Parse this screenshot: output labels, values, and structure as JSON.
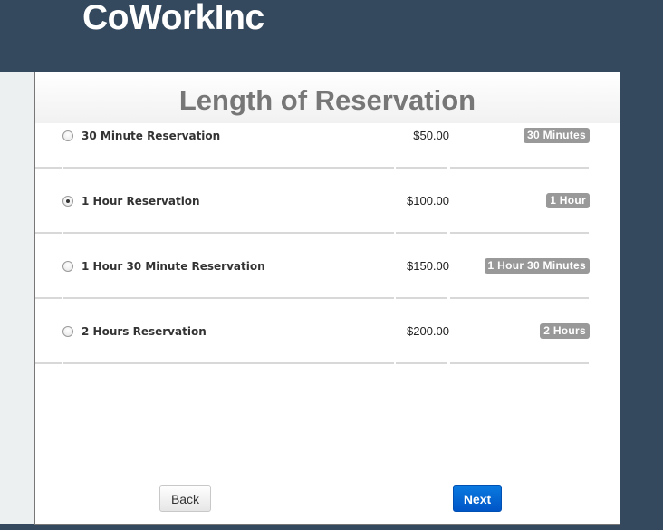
{
  "app": {
    "brand": "CoWorkInc"
  },
  "panel": {
    "title": "Length of Reservation",
    "options": [
      {
        "label": "30 Minute Reservation",
        "price": "$50.00",
        "duration": "30 Minutes",
        "selected": false
      },
      {
        "label": "1 Hour Reservation",
        "price": "$100.00",
        "duration": "1 Hour",
        "selected": true
      },
      {
        "label": "1 Hour 30 Minute Reservation",
        "price": "$150.00",
        "duration": "1 Hour 30 Minutes",
        "selected": false
      },
      {
        "label": "2 Hours Reservation",
        "price": "$200.00",
        "duration": "2 Hours",
        "selected": false
      }
    ]
  },
  "buttons": {
    "back": "Back",
    "next": "Next"
  },
  "colors": {
    "header_bg": "#34495e",
    "badge_bg": "#999999",
    "primary": "#0066cc"
  }
}
